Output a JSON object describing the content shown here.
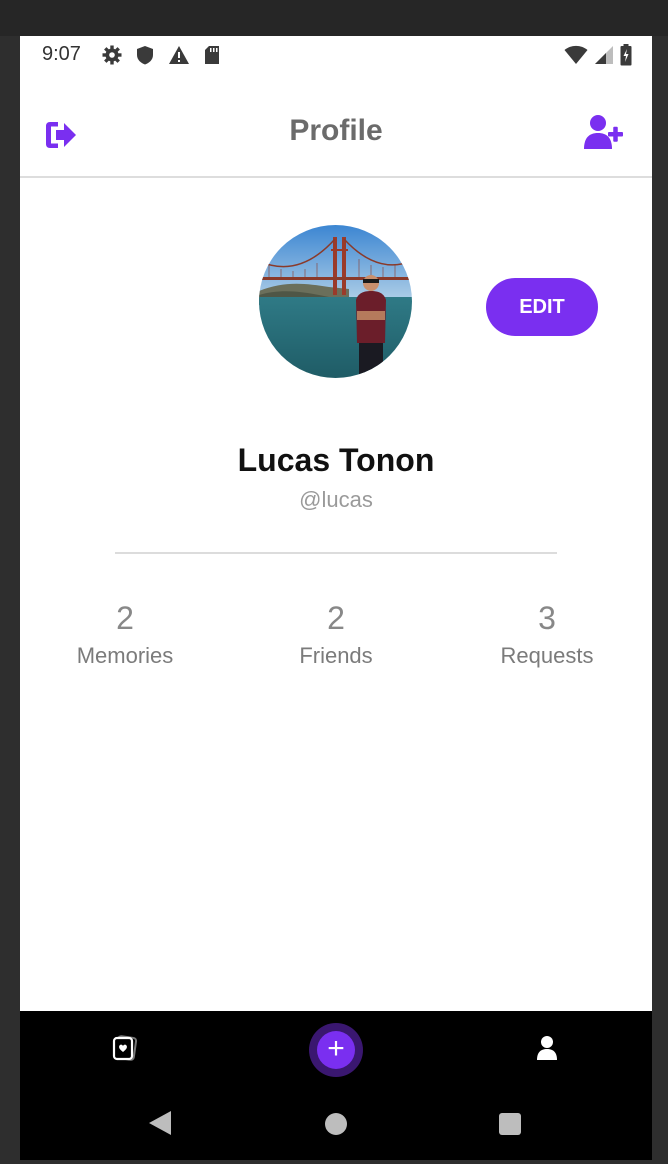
{
  "status_bar": {
    "time": "9:07",
    "left_icons": [
      "settings-icon",
      "shield-icon",
      "alert-icon",
      "sd-card-icon"
    ],
    "right_icons": [
      "wifi-icon",
      "cell-signal-icon",
      "battery-charging-icon"
    ]
  },
  "header": {
    "title": "Profile",
    "left_icon": "logout-icon",
    "right_icon": "add-user-icon",
    "accent_color": "#7a2ff0"
  },
  "profile": {
    "avatar_icon": "profile-photo",
    "edit_label": "EDIT",
    "name": "Lucas Tonon",
    "handle": "@lucas"
  },
  "stats": [
    {
      "count": "2",
      "label": "Memories"
    },
    {
      "count": "2",
      "label": "Friends"
    },
    {
      "count": "3",
      "label": "Requests"
    }
  ],
  "bottom_nav": {
    "items": [
      "memories-icon",
      "add-icon",
      "profile-icon"
    ],
    "add_symbol": "+"
  },
  "system_nav": {
    "items": [
      "back-icon",
      "home-icon",
      "recents-icon"
    ]
  }
}
